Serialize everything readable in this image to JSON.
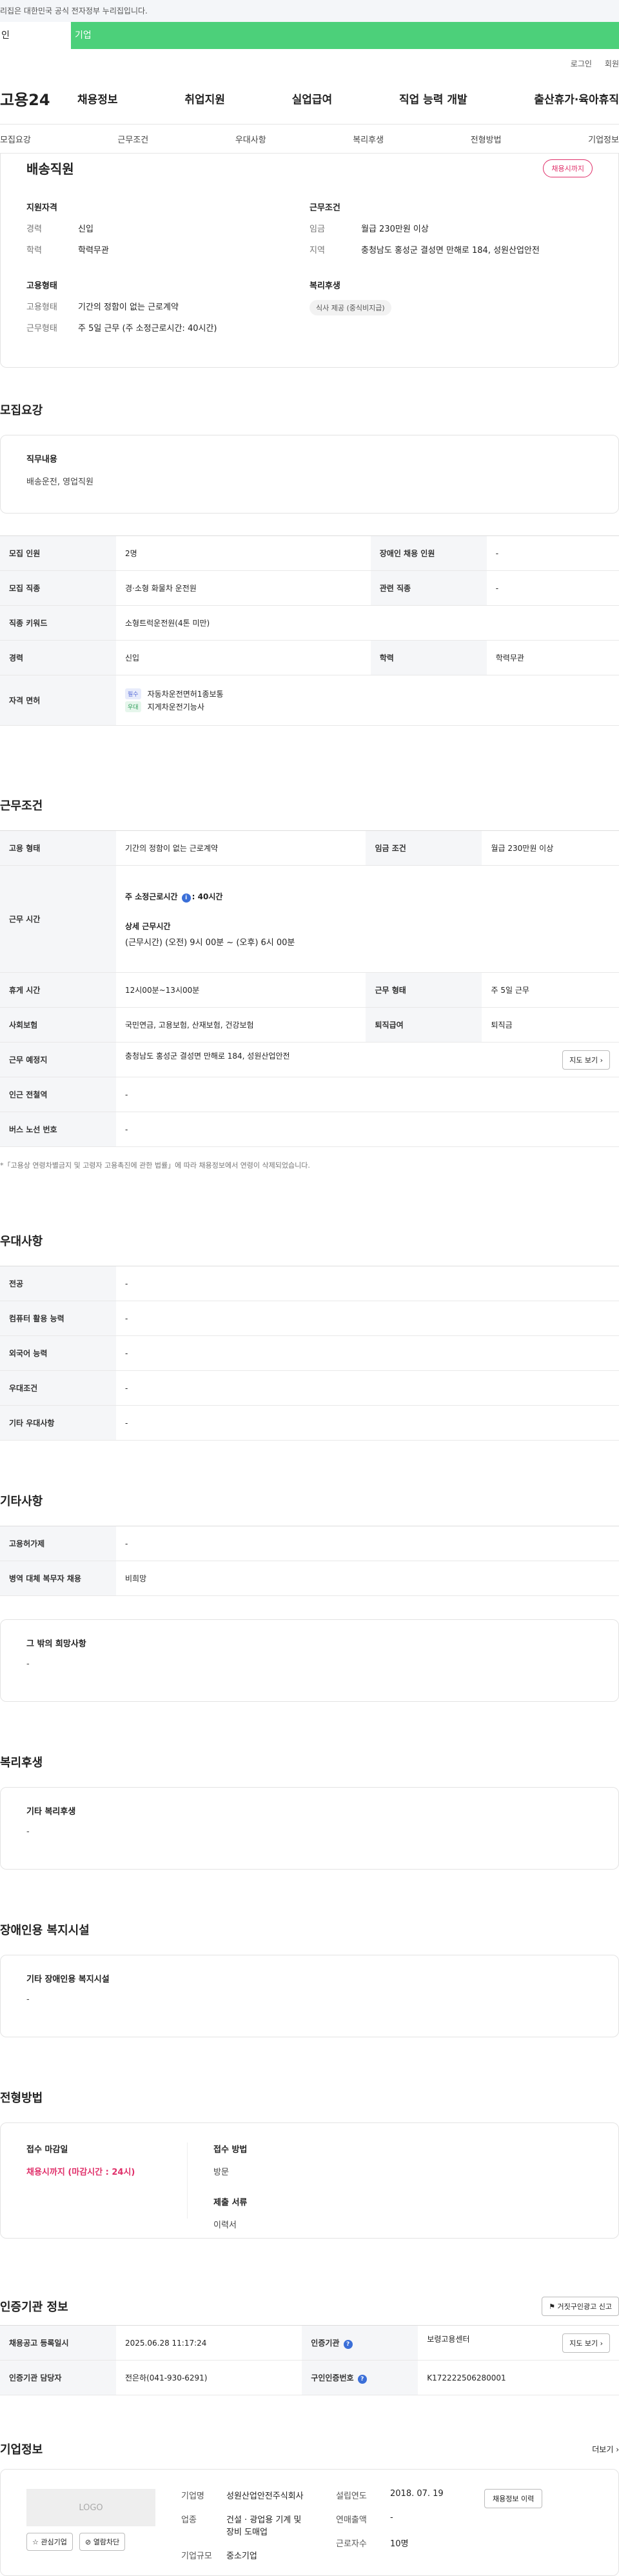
{
  "banner": {
    "text": "리집은 대한민국 공식 전자정부 누리집입니다."
  },
  "tabs": {
    "personal": "인",
    "company": "기업"
  },
  "util": {
    "login": "로그인",
    "join": "회원"
  },
  "gnb": {
    "logo": "고용24",
    "menu": [
      "채용정보",
      "취업지원",
      "실업급여",
      "직업 능력 개발",
      "출산휴가·육아휴직"
    ]
  },
  "subnav": [
    "모집요강",
    "근무조건",
    "우대사항",
    "복리후생",
    "전형방법",
    "기업정보"
  ],
  "summary": {
    "title": "배송직원",
    "badge": "채용시까지",
    "qual_title": "지원자격",
    "qual": [
      {
        "k": "경력",
        "v": "신입"
      },
      {
        "k": "학력",
        "v": "학력무관"
      }
    ],
    "cond_title": "근무조건",
    "cond": [
      {
        "k": "임금",
        "v": "월급 230만원 이상"
      },
      {
        "k": "지역",
        "v": "충청남도 홍성군 결성면 만해로 184, 성원산업안전"
      }
    ],
    "emp_title": "고용형태",
    "emp": [
      {
        "k": "고용형태",
        "v": "기간의 정함이 없는 근로계약"
      },
      {
        "k": "근무형태",
        "v": "주 5일 근무 (주 소정근로시간: 40시간)"
      }
    ],
    "welfare_title": "복리후생",
    "welfare_chip": "식사 제공 (중식비지급)"
  },
  "recruit": {
    "heading": "모집요강",
    "job_desc_label": "직무내용",
    "job_desc_value": "배송운전, 영업직원",
    "rows": {
      "headcount_label": "모집 인원",
      "headcount": "2명",
      "disabled_label": "장애인 채용 인원",
      "disabled": "-",
      "job_label": "모집 직종",
      "job": "경·소형 화물차 운전원",
      "related_label": "관련 직종",
      "related": "-",
      "keyword_label": "직종 키워드",
      "keyword": "소형트럭운전원(4톤 미만)",
      "career_label": "경력",
      "career": "신입",
      "edu_label": "학력",
      "edu": "학력무관",
      "license_label": "자격 면허",
      "license": [
        {
          "tag": "필수",
          "name": "자동차운전면허1종보통"
        },
        {
          "tag": "우대",
          "name": "지게차운전기능사"
        }
      ]
    }
  },
  "work": {
    "heading": "근무조건",
    "type_label": "고용 형태",
    "type": "기간의 정함이 없는 근로계약",
    "wage_label": "임금 조건",
    "wage": "월급 230만원 이상",
    "hours_label": "근무 시간",
    "hours_main": "주 소정근로시간",
    "hours_main_value": ": 40시간",
    "hours_detail_title": "상세 근무시간",
    "hours_detail": "(근무시간) (오전) 9시 00분 ~ (오후) 6시 00분",
    "break_label": "휴게 시간",
    "break": "12시00분~13시00분",
    "shape_label": "근무 형태",
    "shape": "주 5일 근무",
    "insurance_label": "사회보험",
    "insurance": "국민연금, 고용보험, 산재보험, 건강보험",
    "retire_label": "퇴직급여",
    "retire": "퇴직금",
    "place_label": "근무 예정지",
    "place": "충청남도 홍성군 결성면 만해로 184, 성원산업안전",
    "map_btn": "지도 보기",
    "subway_label": "인근 전철역",
    "subway": "-",
    "bus_label": "버스 노선 번호",
    "bus": "-",
    "note": "*「고용상 연령차별금지 및 고령자 고용촉진에 관한 법률」에 따라 채용정보에서 연령이 삭제되었습니다."
  },
  "pref": {
    "heading": "우대사항",
    "rows": [
      {
        "label": "전공",
        "value": "-"
      },
      {
        "label": "컴퓨터 활용 능력",
        "value": "-"
      },
      {
        "label": "외국어 능력",
        "value": "-"
      },
      {
        "label": "우대조건",
        "value": "-"
      },
      {
        "label": "기타 우대사항",
        "value": "-"
      }
    ]
  },
  "etc": {
    "heading": "기타사항",
    "rows": [
      {
        "label": "고용허가제",
        "value": "-"
      },
      {
        "label": "병역 대체 복무자 채용",
        "value": "비희망"
      }
    ],
    "wish_label": "그 밖의 희망사항",
    "wish_value": "-"
  },
  "welfare": {
    "heading": "복리후생",
    "label": "기타 복리후생",
    "value": "-"
  },
  "disabled": {
    "heading": "장애인용 복지시설",
    "label": "기타 장애인용 복지시설",
    "value": "-"
  },
  "selection": {
    "heading": "전형방법",
    "deadline_label": "접수 마감일",
    "deadline": "채용시까지 (마감시간 : 24시)",
    "method_label": "접수 방법",
    "method": "방문",
    "docs_label": "제출 서류",
    "docs": "이력서"
  },
  "cert": {
    "heading": "인증기관 정보",
    "report_btn": "거짓구인광고 신고",
    "reg_label": "채용공고 등록일시",
    "reg": "2025.06.28 11:17:24",
    "org_label": "인증기관",
    "org": "보령고용센터",
    "map_btn": "지도 보기",
    "manager_label": "인증기관 담당자",
    "manager": "전은하(041-930-6291)",
    "num_label": "구인인증번호",
    "num": "K172222506280001"
  },
  "company": {
    "heading": "기업정보",
    "more": "더보기",
    "logo": "LOGO",
    "fav_btn": "관심기업",
    "block_btn": "열람차단",
    "name_label": "기업명",
    "name": "성원산업안전주식회사",
    "biz_label": "업종",
    "biz": "건설 · 광업용 기계 및 장비 도매업",
    "size_label": "기업규모",
    "size": "중소기업",
    "founded_label": "설립연도",
    "founded": "2018. 07. 19",
    "sales_label": "연매출액",
    "sales": "-",
    "employees_label": "근로자수",
    "employees": "10명",
    "history_btn": "채용정보 이력"
  }
}
